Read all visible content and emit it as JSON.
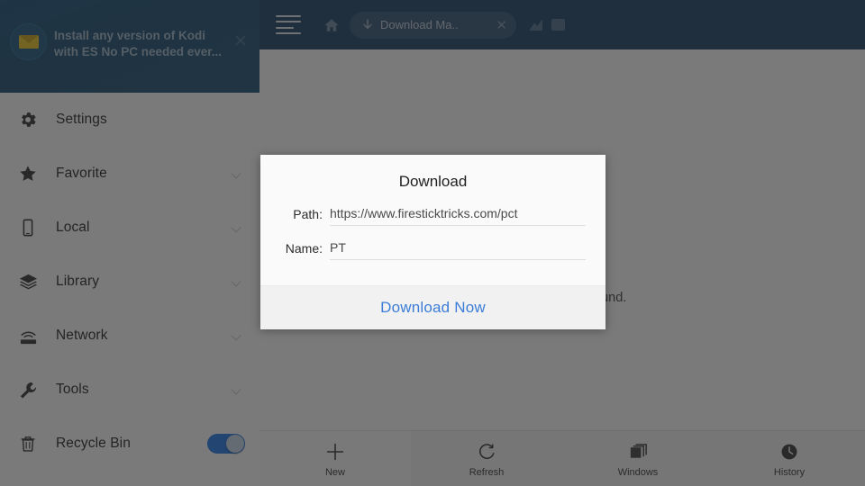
{
  "promo": {
    "line1": "Install any version of Kodi",
    "line2": "with ES No PC needed ever...",
    "icon": "envelope-icon",
    "close_icon": "close-icon"
  },
  "topbar": {
    "menu_icon": "hamburger-menu-icon",
    "home_icon": "home-icon",
    "tab": {
      "icon": "download-arrow-icon",
      "label": "Download Ma..",
      "close_icon": "close-icon"
    },
    "right_icons": [
      "image-icon",
      "stop-icon"
    ]
  },
  "sidebar": {
    "items": [
      {
        "label": "Settings",
        "icon": "gear-icon",
        "chevron": false,
        "toggle": null
      },
      {
        "label": "Favorite",
        "icon": "star-icon",
        "chevron": true,
        "toggle": null
      },
      {
        "label": "Local",
        "icon": "phone-icon",
        "chevron": true,
        "toggle": null
      },
      {
        "label": "Library",
        "icon": "layers-icon",
        "chevron": true,
        "toggle": null
      },
      {
        "label": "Network",
        "icon": "network-icon",
        "chevron": true,
        "toggle": null
      },
      {
        "label": "Tools",
        "icon": "wrench-icon",
        "chevron": true,
        "toggle": null
      },
      {
        "label": "Recycle Bin",
        "icon": "trash-icon",
        "chevron": false,
        "toggle": "on"
      }
    ]
  },
  "content": {
    "empty_message": "No file or folder found."
  },
  "bottombar": {
    "items": [
      {
        "label": "New",
        "icon": "plus-icon"
      },
      {
        "label": "Refresh",
        "icon": "refresh-icon"
      },
      {
        "label": "Windows",
        "icon": "windows-stack-icon"
      },
      {
        "label": "History",
        "icon": "clock-icon"
      }
    ]
  },
  "dialog": {
    "title": "Download",
    "path_label": "Path:",
    "path_value": "https://www.firesticktricks.com/pct",
    "name_label": "Name:",
    "name_value": "PT",
    "cta_label": "Download Now"
  },
  "colors": {
    "topbar": "#123a63",
    "accent_link": "#3b7dd8",
    "toggle_on": "#1a73e8",
    "scrim": "rgba(40,40,40,0.62)"
  }
}
